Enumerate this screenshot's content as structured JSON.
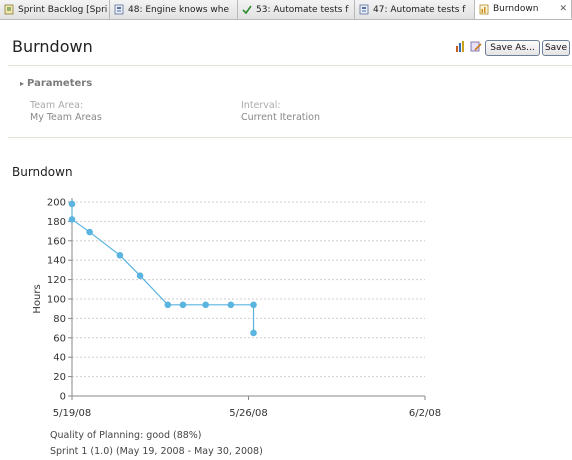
{
  "tabs": [
    {
      "label": "Sprint Backlog [Spri",
      "icon": "plan-icon",
      "active": false
    },
    {
      "label": "48: Engine knows whe",
      "icon": "work-item-icon",
      "active": false
    },
    {
      "label": "53: Automate tests f",
      "icon": "check-icon",
      "active": false
    },
    {
      "label": "47: Automate tests f",
      "icon": "work-item-icon",
      "active": false
    },
    {
      "label": "Burndown",
      "icon": "report-icon",
      "active": true
    }
  ],
  "header": {
    "title": "Burndown",
    "save_as_label": "Save As...",
    "save_label": "Save"
  },
  "parameters": {
    "heading": "Parameters",
    "team_area_label": "Team Area:",
    "team_area_value": "My Team Areas",
    "interval_label": "Interval:",
    "interval_value": "Current Iteration"
  },
  "section_title": "Burndown",
  "chart_data": {
    "type": "line",
    "ylabel": "Hours",
    "xlabel": "",
    "ylim": [
      0,
      200
    ],
    "yticks": [
      0,
      20,
      40,
      60,
      80,
      100,
      120,
      140,
      160,
      180,
      200
    ],
    "x_tick_labels": [
      "5/19/08",
      "5/26/08",
      "6/2/08"
    ],
    "x_tick_days": [
      0,
      7,
      14
    ],
    "grid": true,
    "series": [
      {
        "points": [
          [
            0.0,
            198
          ],
          [
            0.0,
            182
          ],
          [
            0.7,
            169
          ],
          [
            1.9,
            145
          ],
          [
            2.7,
            124
          ],
          [
            3.8,
            94
          ],
          [
            4.4,
            94
          ],
          [
            5.3,
            94
          ],
          [
            6.3,
            94
          ],
          [
            7.2,
            94
          ],
          [
            7.2,
            65
          ]
        ],
        "color": "#5ab4e0"
      }
    ]
  },
  "footer": {
    "quality": "Quality of Planning: good (88%)",
    "sprint": "Sprint 1 (1.0) (May 19, 2008 - May 30, 2008)"
  },
  "colors": {
    "accent": "#5ab4e0",
    "grid": "#cfcfcf"
  }
}
